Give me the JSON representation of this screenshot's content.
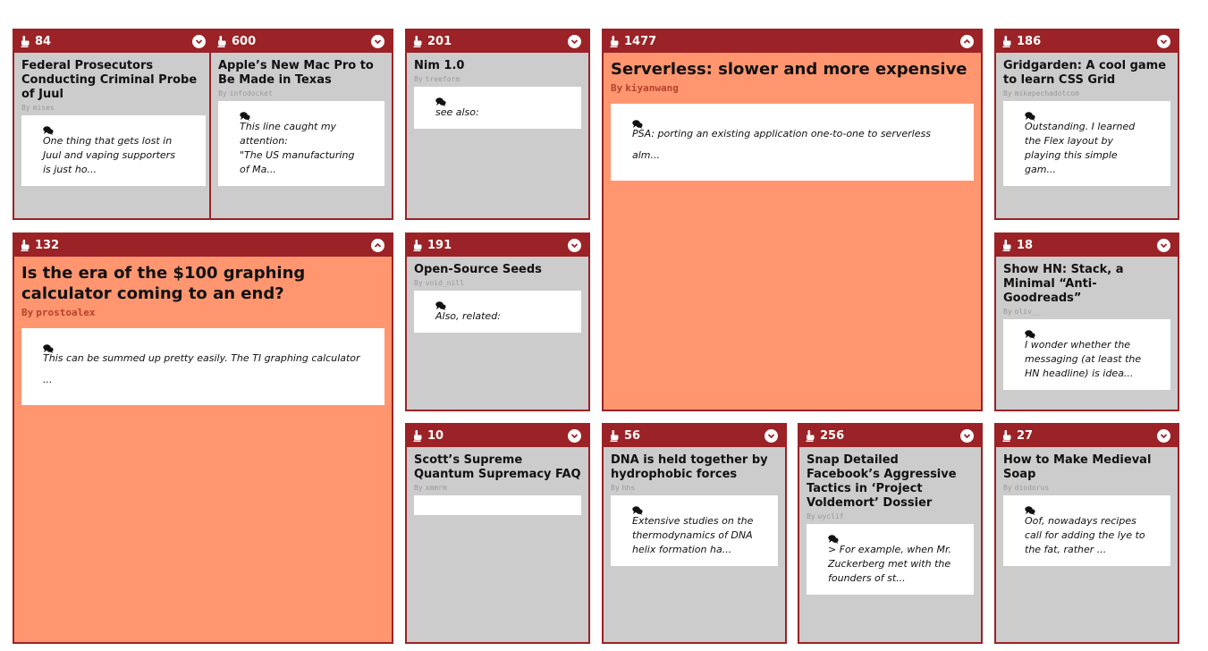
{
  "colors": {
    "header": "#9b2226",
    "card": "#cccccc",
    "featured": "#ff9670",
    "comment_bg": "#ffffff"
  },
  "icons": {
    "score": "thumbs-up-icon",
    "toggle": "chevron-circle-icon",
    "comment": "comment-icon"
  },
  "author_prefix": "By",
  "stories": [
    {
      "score": "84",
      "title": "Federal Prosecutors Conducting Criminal Probe of Juul",
      "author": "mises",
      "comment": "One thing that gets lost in Juul and vaping supporters is just ho...",
      "expanded": false
    },
    {
      "score": "600",
      "title": "Apple’s New Mac Pro to Be Made in Texas",
      "author": "infodocket",
      "comment": "This line caught my attention:\n\"The US manufacturing of Ma...",
      "expanded": false
    },
    {
      "score": "201",
      "title": "Nim 1.0",
      "author": "treeform",
      "comment": "see also:",
      "expanded": false
    },
    {
      "score": "1477",
      "title": "Serverless: slower and more expensive",
      "author": "kiyanwang",
      "comment": "PSA: porting an existing application one-to-one to serverless alm...",
      "expanded": true
    },
    {
      "score": "186",
      "title": "Gridgarden: A cool game to learn CSS Grid",
      "author": "mikepechadotcom",
      "comment": "Outstanding. I learned the Flex layout by playing this simple gam...",
      "expanded": false
    },
    {
      "score": "132",
      "title": "Is the era of the $100 graphing calculator coming to an end?",
      "author": "prostoalex",
      "comment": "This can be summed up pretty easily. The TI graphing calculator ...",
      "expanded": true
    },
    {
      "score": "191",
      "title": "Open-Source Seeds",
      "author": "void_nill",
      "comment": "Also, related:",
      "expanded": false
    },
    {
      "score": "18",
      "title": "Show HN: Stack, a Minimal “Anti-Goodreads”",
      "author": "oliv__",
      "comment": "I wonder whether the messaging (at least the HN headline) is idea...",
      "expanded": false
    },
    {
      "score": "10",
      "title": "Scott’s Supreme Quantum Supremacy FAQ",
      "author": "xmmrm",
      "comment": "",
      "expanded": false
    },
    {
      "score": "56",
      "title": "DNA is held together by hydrophobic forces",
      "author": "hhs",
      "comment": "Extensive studies on the thermodynamics of DNA helix formation ha...",
      "expanded": false
    },
    {
      "score": "256",
      "title": "Snap Detailed Facebook’s Aggressive Tactics in ‘Project Voldemort’ Dossier",
      "author": "wyclif",
      "comment": "> For example, when Mr. Zuckerberg met with the founders of st...",
      "expanded": false
    },
    {
      "score": "27",
      "title": "How to Make Medieval Soap",
      "author": "diodorus",
      "comment": "Oof, nowadays recipes call for adding the lye to the fat, rather ...",
      "expanded": false
    }
  ]
}
